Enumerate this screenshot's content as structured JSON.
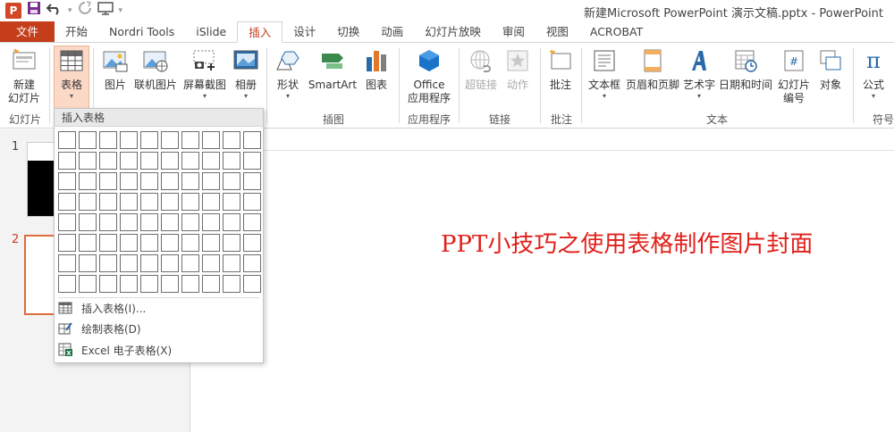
{
  "window": {
    "title": "新建Microsoft PowerPoint 演示文稿.pptx - PowerPoint",
    "logo_letter": "P"
  },
  "qat": {
    "save_icon": "save-icon",
    "undo_icon": "undo-icon",
    "redo_icon": "redo-icon",
    "present_icon": "present-icon"
  },
  "tabs": [
    {
      "label": "文件"
    },
    {
      "label": "开始"
    },
    {
      "label": "Nordri Tools"
    },
    {
      "label": "iSlide"
    },
    {
      "label": "插入"
    },
    {
      "label": "设计"
    },
    {
      "label": "切换"
    },
    {
      "label": "动画"
    },
    {
      "label": "幻灯片放映"
    },
    {
      "label": "审阅"
    },
    {
      "label": "视图"
    },
    {
      "label": "ACROBAT"
    }
  ],
  "ribbon": {
    "new_slide": {
      "line1": "新建",
      "line2": "幻灯片"
    },
    "table": "表格",
    "picture": "图片",
    "online_picture": "联机图片",
    "screenshot": "屏幕截图",
    "album": "相册",
    "shapes": "形状",
    "smartart": "SmartArt",
    "chart": "图表",
    "office_apps": {
      "line1": "Office",
      "line2": "应用程序"
    },
    "hyperlink": "超链接",
    "action": "动作",
    "comment": "批注",
    "textbox": "文本框",
    "header_footer": "页眉和页脚",
    "wordart": "艺术字",
    "datetime": "日期和时间",
    "slide_number": {
      "line1": "幻灯片",
      "line2": "编号"
    },
    "object": "对象",
    "equation": "公式",
    "groups": {
      "slides": "幻灯片",
      "illustrations": "插图",
      "apps": "应用程序",
      "links": "链接",
      "comments": "批注",
      "text": "文本",
      "symbols": "符号"
    }
  },
  "dropdown": {
    "header": "插入表格",
    "grid_cols": 10,
    "grid_rows": 8,
    "items": [
      {
        "label": "插入表格(I)..."
      },
      {
        "label": "绘制表格(D)"
      },
      {
        "label": "Excel 电子表格(X)"
      }
    ]
  },
  "slides": [
    {
      "number": "1"
    },
    {
      "number": "2"
    }
  ],
  "slide": {
    "title": "PPT小技巧之使用表格制作图片封面"
  },
  "colors": {
    "accent": "#c43e1c",
    "slide_title": "#e0201a"
  }
}
